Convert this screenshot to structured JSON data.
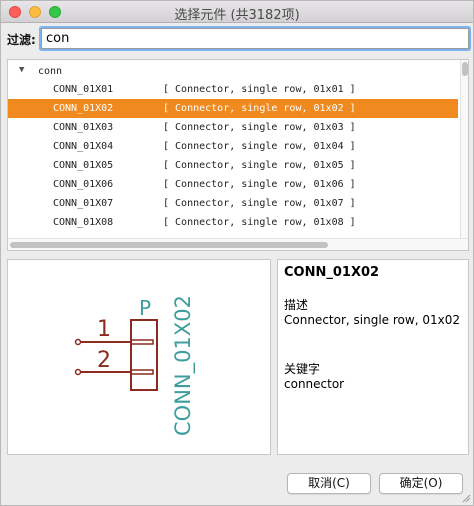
{
  "window": {
    "title": "选择元件 (共3182项)"
  },
  "filter": {
    "label": "过滤:",
    "value": "con"
  },
  "tree": {
    "group": {
      "arrow": "▼",
      "name": "conn"
    },
    "rows": [
      {
        "name": "CONN_01X01",
        "desc": "[ Connector, single row, 01x01 ]",
        "selected": false
      },
      {
        "name": "CONN_01X02",
        "desc": "[ Connector, single row, 01x02 ]",
        "selected": true
      },
      {
        "name": "CONN_01X03",
        "desc": "[ Connector, single row, 01x03 ]",
        "selected": false
      },
      {
        "name": "CONN_01X04",
        "desc": "[ Connector, single row, 01x04 ]",
        "selected": false
      },
      {
        "name": "CONN_01X05",
        "desc": "[ Connector, single row, 01x05 ]",
        "selected": false
      },
      {
        "name": "CONN_01X06",
        "desc": "[ Connector, single row, 01x06 ]",
        "selected": false
      },
      {
        "name": "CONN_01X07",
        "desc": "[ Connector, single row, 01x07 ]",
        "selected": false
      },
      {
        "name": "CONN_01X08",
        "desc": "[ Connector, single row, 01x08 ]",
        "selected": false
      }
    ]
  },
  "preview": {
    "ref": "P",
    "value": "CONN_01X02",
    "pin1": "1",
    "pin2": "2",
    "colors": {
      "body": "#8b2a1f",
      "text": "#3f9d9d"
    }
  },
  "info": {
    "name": "CONN_01X02",
    "desc_label": "描述",
    "desc_text": "Connector, single row, 01x02",
    "keywords_label": "关键字",
    "keywords_text": "connector"
  },
  "buttons": {
    "cancel": "取消(C)",
    "ok": "确定(O)"
  },
  "colors": {
    "selection": "#f0891e"
  }
}
